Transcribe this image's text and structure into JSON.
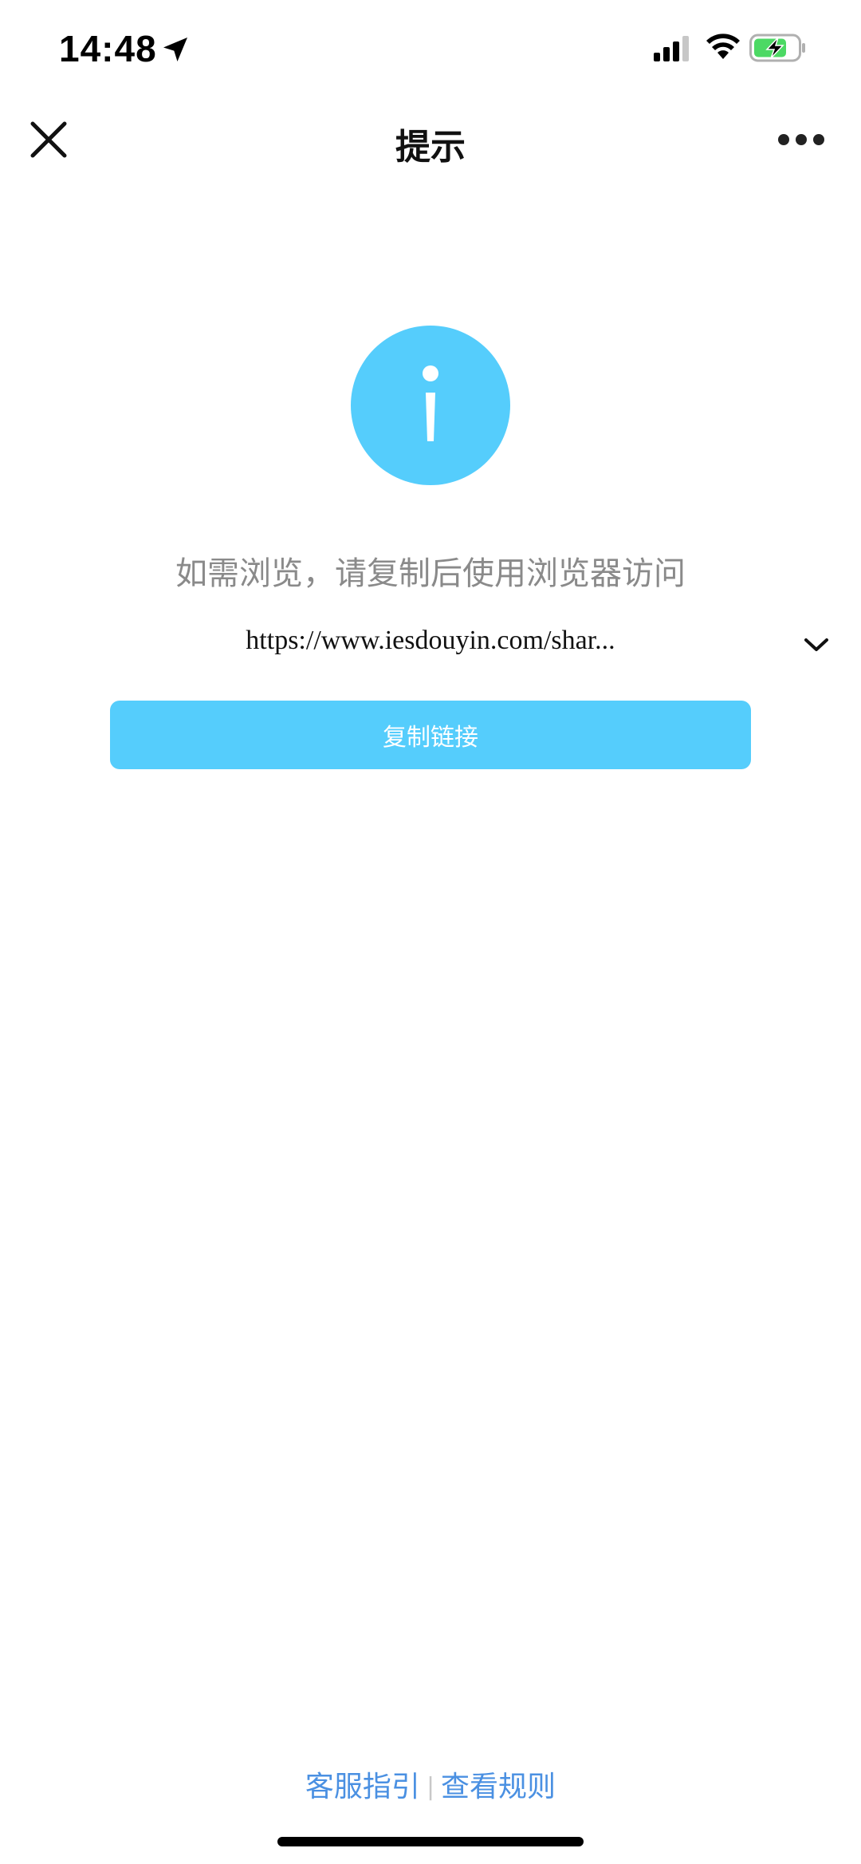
{
  "status_bar": {
    "time": "14:48",
    "icons": [
      "location-arrow-icon",
      "cellular-signal-icon",
      "wifi-icon",
      "battery-charging-icon"
    ],
    "battery_color": "#4cd964"
  },
  "nav": {
    "title": "提示",
    "close_icon": "close-icon",
    "more_icon": "more-horizontal-icon"
  },
  "main": {
    "icon": "info-icon",
    "icon_color": "#55cdfc",
    "hint": "如需浏览，请复制后使用浏览器访问",
    "url": "https://www.iesdouyin.com/shar...",
    "expand_icon": "chevron-down-icon",
    "copy_button_label": "复制链接",
    "accent_color": "#55cdfc"
  },
  "footer": {
    "link_guide": "客服指引",
    "divider": "|",
    "link_rules": "查看规则",
    "link_color": "#4a90e2"
  }
}
